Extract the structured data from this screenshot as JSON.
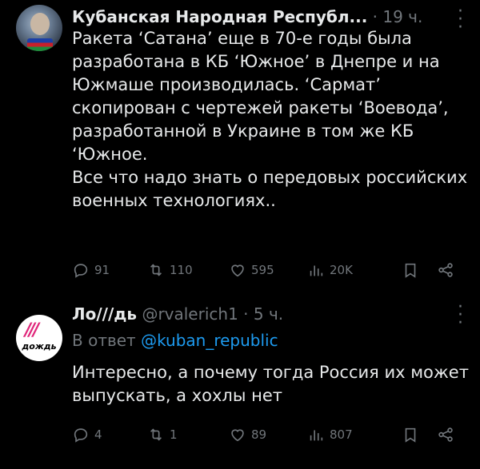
{
  "tweets": [
    {
      "author_name": "Кубанская Народная Республ...",
      "handle": "",
      "time": "· 19 ч.",
      "reply_to_prefix": "",
      "reply_to_mention": "",
      "body_paragraphs": [
        "Ракета ‘Сатана’ еще в 70-е годы была разработана в КБ ‘Южное’ в Днепре и на Южмаше производилась. ‘Сармат’ скопирован с чертежей ракеты ‘Воевода’, разработанной в Украине в том же КБ ‘Южное.",
        "Все что надо знать о передовых российских военных технологиях.."
      ],
      "stats": {
        "replies": "91",
        "retweets": "110",
        "likes": "595",
        "views": "20K"
      }
    },
    {
      "author_name": "Ло///дь",
      "handle": "@rvalerich1",
      "time": "· 5 ч.",
      "reply_to_prefix": "В ответ",
      "reply_to_mention": "@kuban_republic",
      "body_paragraphs": [
        "Интересно, а почему тогда Россия их может выпускать, а хохлы нет"
      ],
      "stats": {
        "replies": "4",
        "retweets": "1",
        "likes": "89",
        "views": "807"
      }
    }
  ],
  "avatar2_logo_text": "дождь",
  "icons": [
    "more-icon",
    "reply-icon",
    "retweet-icon",
    "like-icon",
    "views-icon",
    "bookmark-icon",
    "share-icon"
  ],
  "colors": {
    "background": "#000000",
    "text": "#e7e9ea",
    "muted": "#71767b",
    "link": "#1d9bf0"
  }
}
